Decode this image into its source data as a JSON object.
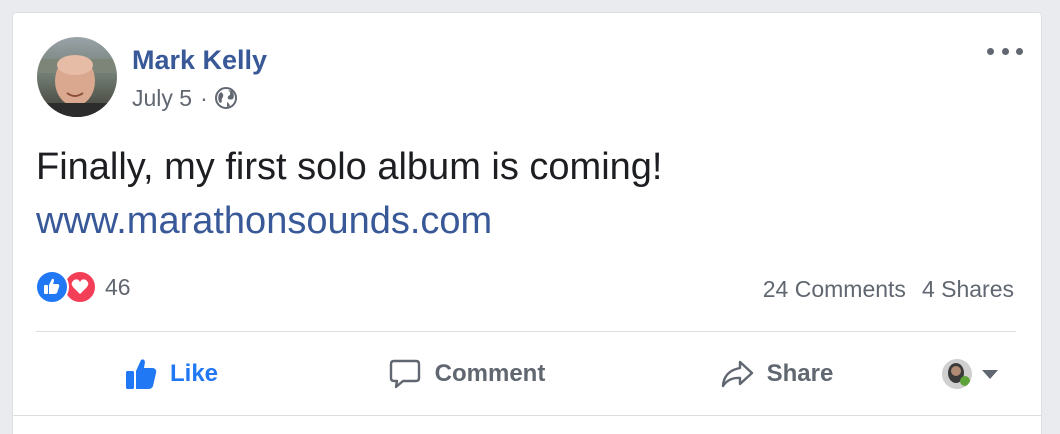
{
  "post": {
    "author": "Mark Kelly",
    "date": "July 5",
    "separator": "·",
    "privacy_icon": "globe-icon",
    "text": "Finally, my first solo album is coming!",
    "link": "www.marathonsounds.com"
  },
  "reactions": {
    "icons": [
      "like-reaction-icon",
      "love-reaction-icon"
    ],
    "count": "46",
    "comments": "24 Comments",
    "shares": "4 Shares"
  },
  "actions": {
    "like_label": "Like",
    "comment_label": "Comment",
    "share_label": "Share"
  },
  "colors": {
    "link": "#385898",
    "like_active": "#2078f4",
    "love": "#f33e58",
    "muted": "#606770"
  }
}
